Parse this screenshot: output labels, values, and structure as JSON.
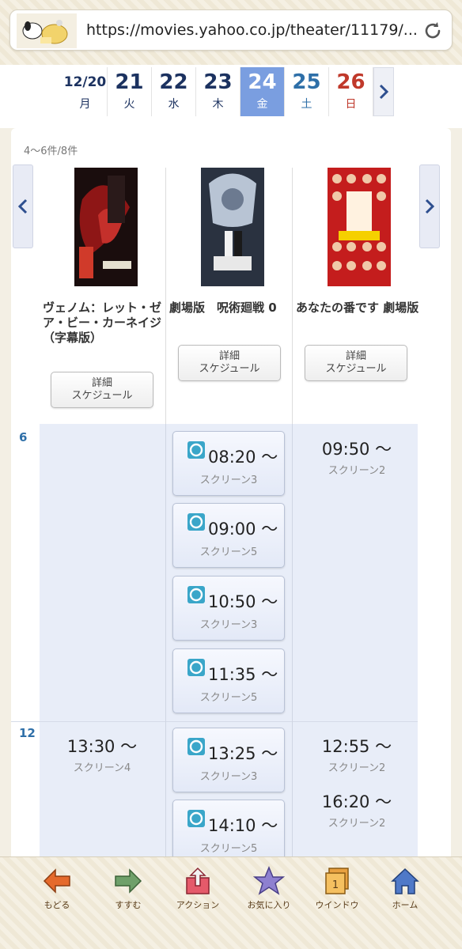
{
  "browser": {
    "url": "https://movies.yahoo.co.jp/theater/11179/..."
  },
  "dates": [
    {
      "num": "12/20",
      "dow": "月",
      "color": "navy"
    },
    {
      "num": "21",
      "dow": "火",
      "color": "navy"
    },
    {
      "num": "22",
      "dow": "水",
      "color": "navy"
    },
    {
      "num": "23",
      "dow": "木",
      "color": "navy"
    },
    {
      "num": "24",
      "dow": "金",
      "color": "white"
    },
    {
      "num": "25",
      "dow": "土",
      "color": "sat"
    },
    {
      "num": "26",
      "dow": "日",
      "color": "sun"
    }
  ],
  "colors": {
    "active_date": "#7a9ee0",
    "schedule_bg": "#e8edf8",
    "hour_label": "#2e6fa8"
  },
  "count_label": "4〜6件/8件",
  "movies": [
    {
      "title": "ヴェノム：レット・ゼア・ビー・カーネイジ（字幕版）",
      "button_line1": "詳細",
      "button_line2": "スケジュール"
    },
    {
      "title": "劇場版　呪術廻戦 0",
      "button_line1": "詳細",
      "button_line2": "スケジュール"
    },
    {
      "title": "あなたの番です 劇場版",
      "button_line1": "詳細",
      "button_line2": "スケジュール"
    }
  ],
  "hours": [
    "6",
    "12"
  ],
  "schedule": {
    "venom": [
      {
        "time": "13:30 〜",
        "screen": "スクリーン4"
      }
    ],
    "jujutsu": [
      {
        "time": "08:20 〜",
        "screen": "スクリーン3"
      },
      {
        "time": "09:00 〜",
        "screen": "スクリーン5"
      },
      {
        "time": "10:50 〜",
        "screen": "スクリーン3"
      },
      {
        "time": "11:35 〜",
        "screen": "スクリーン5"
      },
      {
        "time": "13:25 〜",
        "screen": "スクリーン3"
      },
      {
        "time": "14:10 〜",
        "screen": "スクリーン5"
      }
    ],
    "anaban": [
      {
        "time": "09:50 〜",
        "screen": "スクリーン2"
      },
      {
        "time": "12:55 〜",
        "screen": "スクリーン2"
      },
      {
        "time": "16:20 〜",
        "screen": "スクリーン2"
      }
    ]
  },
  "toolbar": {
    "back": "もどる",
    "forward": "すすむ",
    "action": "アクション",
    "favorite": "お気に入り",
    "window": "ウインドウ",
    "window_count": "1",
    "home": "ホーム"
  },
  "icons": {
    "back": "arrow-left-icon",
    "forward": "arrow-right-icon",
    "action": "share-icon",
    "favorite": "star-icon",
    "window": "windows-icon",
    "home": "home-icon",
    "reload": "reload-icon"
  }
}
